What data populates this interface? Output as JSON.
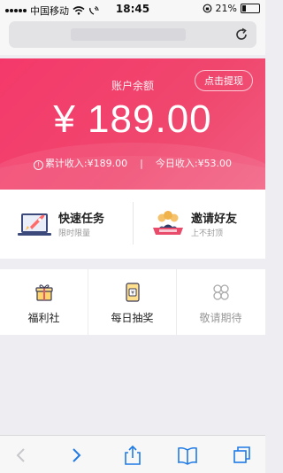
{
  "status_bar": {
    "carrier": "中国移动",
    "time": "18:45",
    "battery": "21%",
    "battery_level": 0.21
  },
  "hero": {
    "balance_label": "账户余额",
    "withdraw_label": "点击提现",
    "balance_amount": "¥ 189.00",
    "cumulative_income": "累计收入:¥189.00",
    "separator": "|",
    "today_income": "今日收入:¥53.00",
    "gradient_colors": [
      "#f4396a",
      "#f25c80"
    ]
  },
  "tasks": [
    {
      "title": "快速任务",
      "subtitle": "限时限量",
      "icon": "rocket-icon"
    },
    {
      "title": "邀请好友",
      "subtitle": "上不封顶",
      "icon": "friends-icon"
    }
  ],
  "grid": [
    {
      "label": "福利社",
      "icon": "gift-icon"
    },
    {
      "label": "每日抽奖",
      "icon": "lottery-icon"
    },
    {
      "label": "敬请期待",
      "icon": "flower-icon"
    }
  ]
}
